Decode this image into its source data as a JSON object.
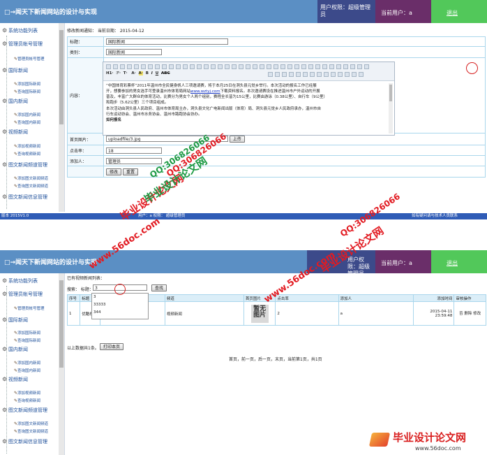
{
  "app": {
    "title": "□→闻天下新闻网站的设计与实现",
    "permission": "用户权限：超级管理员",
    "current_user": "当前用户：a",
    "logout": "退出",
    "title_mark": "□→"
  },
  "sidebar": {
    "heading": "系统功能列表",
    "groups": [
      {
        "label": "管理员帐号管理",
        "items": [
          "管理员帐号管理"
        ]
      },
      {
        "label": "国际新闻",
        "items": [
          "添加国际新闻",
          "查询国际新闻"
        ]
      },
      {
        "label": "国内新闻",
        "items": [
          "添加国内新闻",
          "查询国内新闻"
        ]
      },
      {
        "label": "视频新闻",
        "items": [
          "添加视频新闻",
          "查询视频新闻"
        ]
      },
      {
        "label": "图文新闻频道管理",
        "items": [
          "添加图文新闻频道",
          "查询图文新闻频道"
        ]
      },
      {
        "label": "图文新闻信息管理",
        "items": []
      }
    ]
  },
  "edit_page": {
    "crumb": "修改新闻通知：  当前日期：  2015-04-12",
    "fields": {
      "title_label": "标题：",
      "title_value": "国际新闻",
      "category_label": "类别：",
      "category_value": "国际新闻",
      "content_label": "内容：",
      "image_label": "首页图片：",
      "image_value": "uploadfile/3.jpg",
      "upload_button": "上传",
      "clicks_label": "点击率：",
      "clicks_value": "18",
      "adder_label": "添加人：",
      "adder_value": "管理员",
      "modify_button": "修改",
      "reset_button": "重置"
    },
    "editor_tools": [
      "H1·",
      "ℱ·",
      "T·",
      "A·",
      "A·",
      "B",
      "I",
      "U",
      "ABC"
    ],
    "content": {
      "p1a": "“中国体育彩票杯”2011年温州市全民健身帆人三项邀请赛，将于本月25日在洞头县元觉乡举行。本次活动的报名工作已经展",
      "p1b": "开，想要参加的男女选手可登录温州市体育局网站",
      "link": "www.wztyj.com",
      "p1c": "下载资料报名。本次邀请赛设在推进温州市户外运动的开展",
      "p1d": "普及，丰富广大群众的体育活动，比赛分为男女个人两个组别，赛程全长皆为15公里，比赛由游泳（0.38公里）、自行车（9公里）",
      "p1e": "和跑步（5.62公里）三个项目组成。",
      "p2a": "本次活动由洞头县人民政府、温州市体育局主办，洞头县文化广电新闻出版（体育）局、洞头县元觉乡人民政府承办，温州市自",
      "p2b": "行车运动协会、温州市水务协会、温州市路跑协会协办。",
      "h": "如何报名"
    },
    "status_left": "版本  2015V1.0",
    "status_mid": "用户：a  权限：  超级管理员",
    "status_right": "如有疑问请与技术人员联系"
  },
  "list_page": {
    "heading": "已有视频新闻列表：",
    "search_label": "搜索：  标题：",
    "search_value": "3",
    "search_button": "查找",
    "suggestions": [
      "3",
      "33333",
      "344"
    ],
    "columns": [
      "序号",
      "标题",
      "",
      "频道",
      "首页图片",
      "点击率",
      "添加人",
      "添加时间",
      "审核操作"
    ],
    "row": {
      "index": "1",
      "title": "优酷视频",
      "channel": "视频新闻",
      "image_text": "暂无图片",
      "clicks": "2",
      "adder": "a",
      "time": "2015-04-11 23:59:48",
      "ops": "否 删除 修改"
    },
    "summary": "以上数据共1条。",
    "print_button": "打印本页",
    "pager": "首页，前一页，后一页，末页，当前第1页，共1页"
  },
  "watermarks": {
    "site": "www.56doc.com",
    "qq": "QQ:306826066",
    "brand": "毕业设计论文网"
  }
}
